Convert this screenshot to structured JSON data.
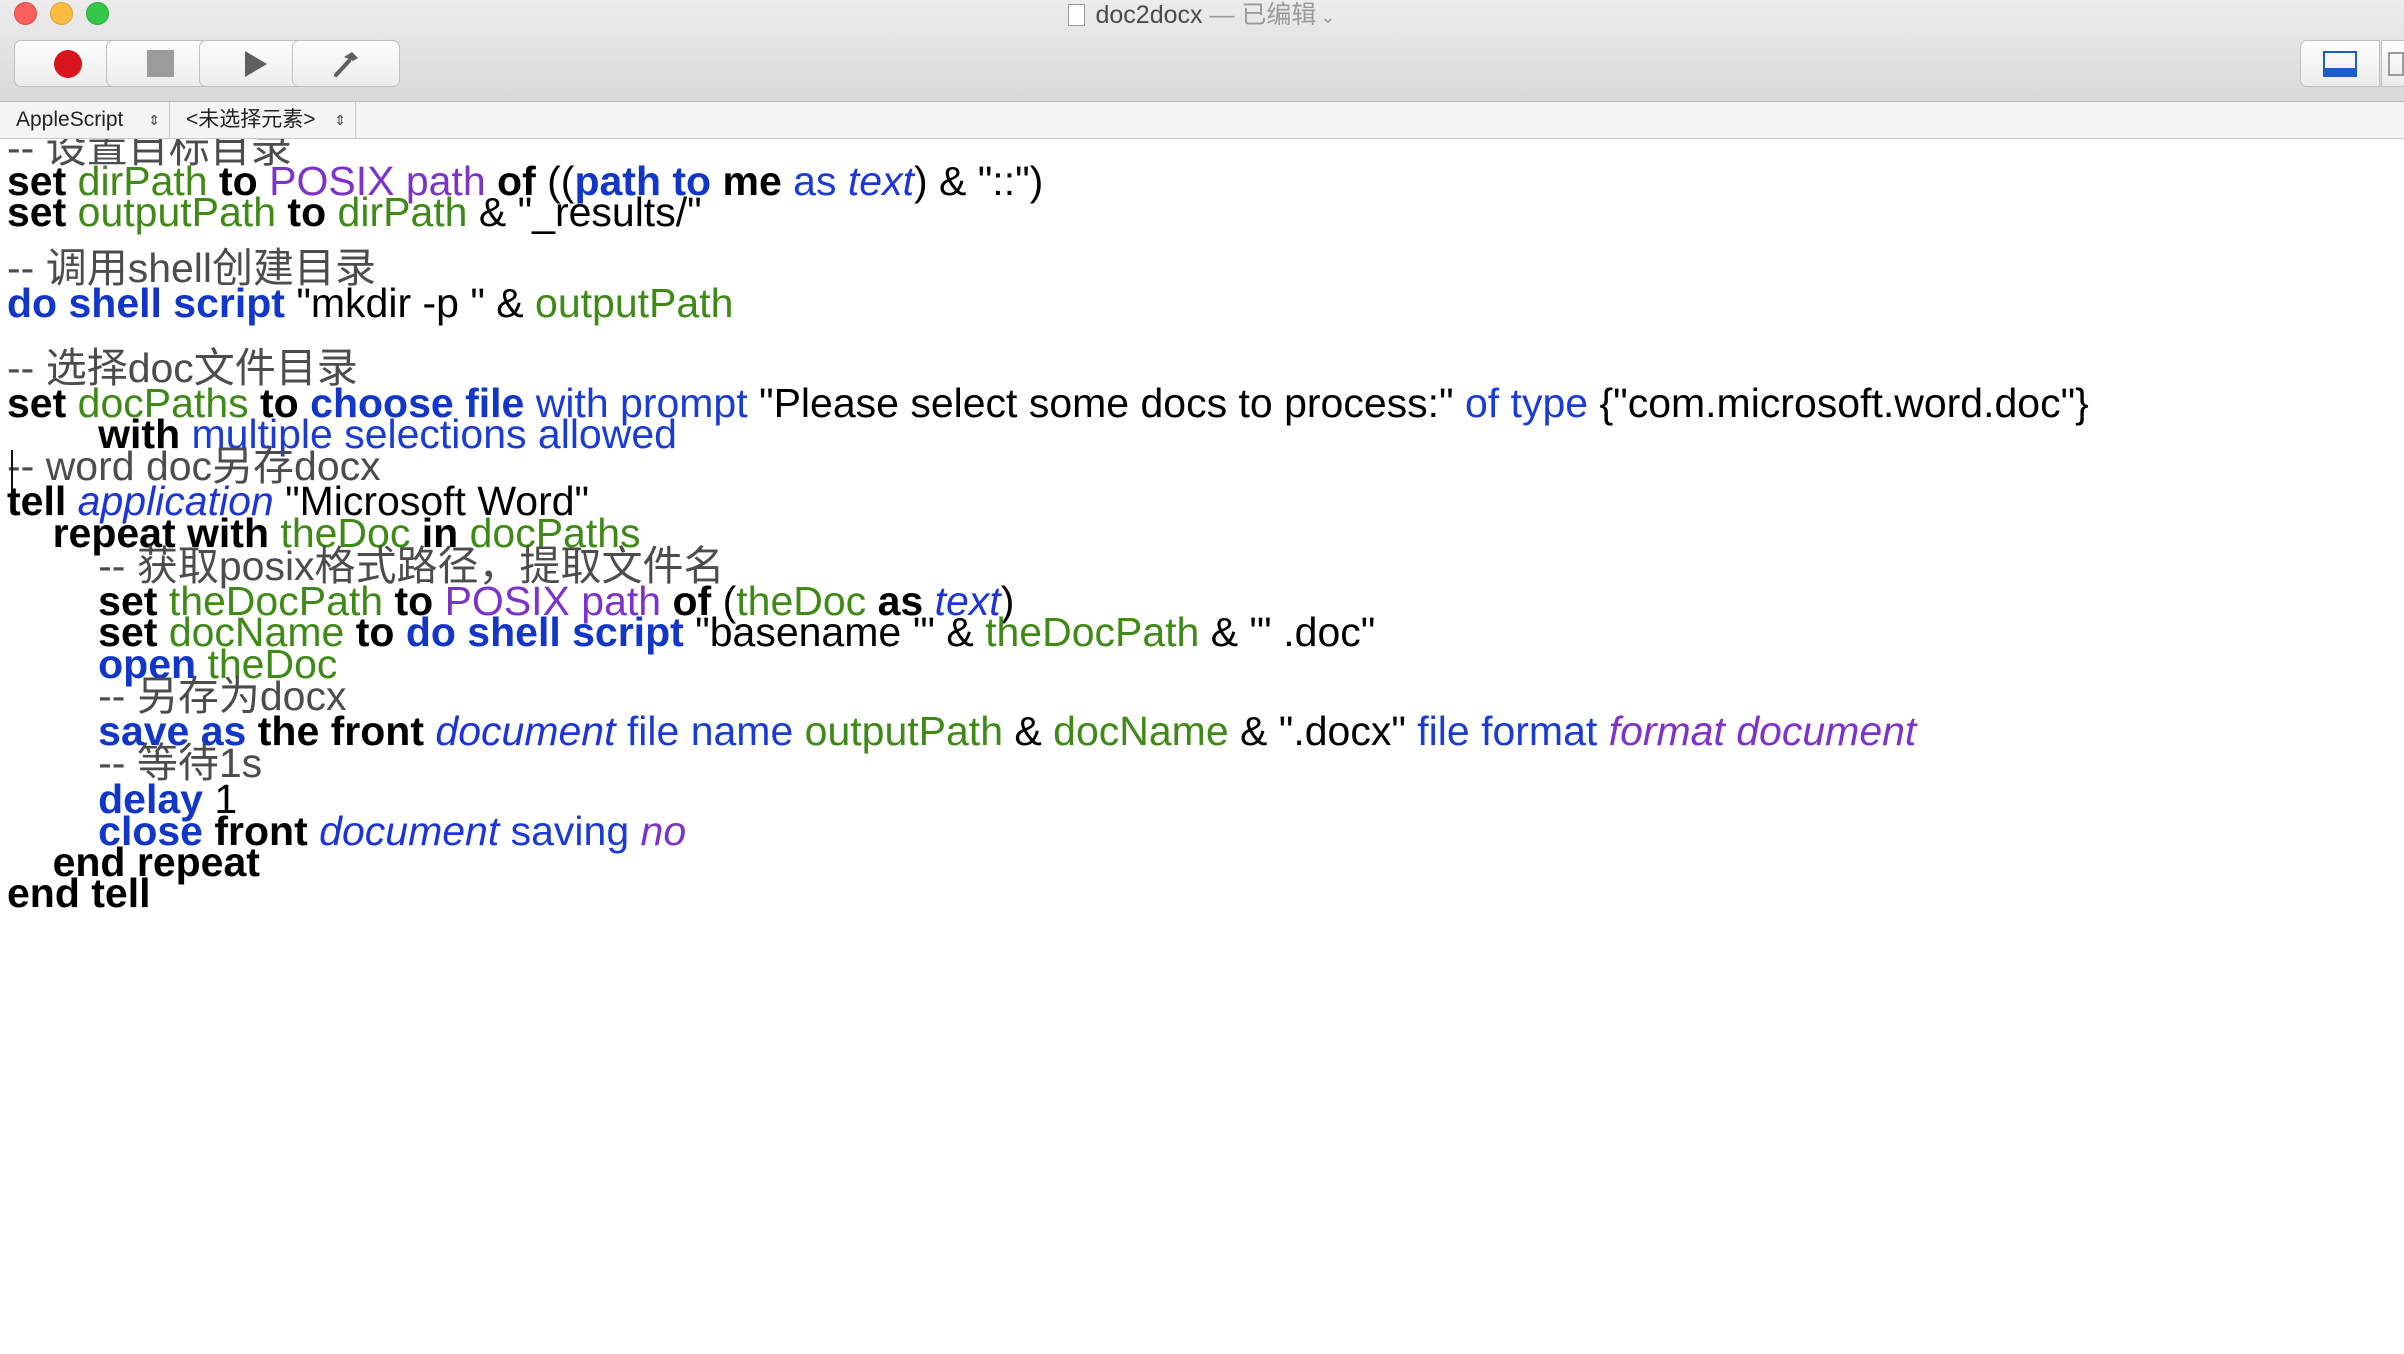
{
  "window": {
    "title": "doc2docx",
    "status": " — 已编辑",
    "chevron": "⌄",
    "traffic_lights": [
      "close",
      "minimize",
      "zoom"
    ]
  },
  "toolbar": {
    "buttons": [
      {
        "name": "record",
        "icon": "record-icon"
      },
      {
        "name": "stop",
        "icon": "stop-icon"
      },
      {
        "name": "run",
        "icon": "play-icon"
      },
      {
        "name": "compile",
        "icon": "hammer-icon"
      }
    ],
    "right_buttons": [
      {
        "name": "show-log",
        "icon": "bottom-panel-icon"
      },
      {
        "name": "show-inspector",
        "icon": "side-panel-icon"
      }
    ]
  },
  "navbar": {
    "language": "AppleScript",
    "element": "<未选择元素>",
    "arrow": "⇕"
  },
  "code": [
    [
      [
        "comment",
        "-- 设置目标目录"
      ]
    ],
    [
      [
        "kw",
        "set"
      ],
      [
        "txt",
        " "
      ],
      [
        "var",
        "dirPath"
      ],
      [
        "txt",
        " "
      ],
      [
        "kw",
        "to"
      ],
      [
        "txt",
        " "
      ],
      [
        "prop",
        "POSIX path"
      ],
      [
        "txt",
        " "
      ],
      [
        "kw",
        "of"
      ],
      [
        "txt",
        " (("
      ],
      [
        "cmd",
        "path to"
      ],
      [
        "txt",
        " "
      ],
      [
        "kw",
        "me"
      ],
      [
        "txt",
        " "
      ],
      [
        "prm",
        "as"
      ],
      [
        "txt",
        " "
      ],
      [
        "cls",
        "text"
      ],
      [
        "txt",
        ") & \"::\")"
      ]
    ],
    [
      [
        "kw",
        "set"
      ],
      [
        "txt",
        " "
      ],
      [
        "var",
        "outputPath"
      ],
      [
        "txt",
        " "
      ],
      [
        "kw",
        "to"
      ],
      [
        "txt",
        " "
      ],
      [
        "var",
        "dirPath"
      ],
      [
        "txt",
        " & \"_results/\""
      ]
    ],
    [],
    [
      [
        "comment",
        "-- 调用shell创建目录"
      ]
    ],
    [
      [
        "cmd",
        "do shell script"
      ],
      [
        "str",
        " \"mkdir -p \" & "
      ],
      [
        "var",
        "outputPath"
      ]
    ],
    [],
    [
      [
        "comment",
        "-- 选择doc文件目录"
      ]
    ],
    [
      [
        "kw",
        "set"
      ],
      [
        "txt",
        " "
      ],
      [
        "var",
        "docPaths"
      ],
      [
        "txt",
        " "
      ],
      [
        "kw",
        "to"
      ],
      [
        "txt",
        " "
      ],
      [
        "cmd",
        "choose file"
      ],
      [
        "txt",
        " "
      ],
      [
        "prm",
        "with prompt"
      ],
      [
        "str",
        " \"Please select some docs to process:\" "
      ],
      [
        "prm",
        "of type"
      ],
      [
        "str",
        " {\"com.microsoft.word.doc\"}"
      ]
    ],
    [
      [
        "txt",
        "        "
      ],
      [
        "kw",
        "with"
      ],
      [
        "txt",
        " "
      ],
      [
        "prm",
        "multiple selections allowed"
      ]
    ],
    [
      [
        "comment",
        "-- word doc另存docx"
      ]
    ],
    [
      [
        "kw",
        "tell"
      ],
      [
        "txt",
        " "
      ],
      [
        "cls",
        "application"
      ],
      [
        "str",
        " \"Microsoft Word\""
      ]
    ],
    [
      [
        "txt",
        "    "
      ],
      [
        "kw",
        "repeat with"
      ],
      [
        "txt",
        " "
      ],
      [
        "var",
        "theDoc"
      ],
      [
        "txt",
        " "
      ],
      [
        "kw",
        "in"
      ],
      [
        "txt",
        " "
      ],
      [
        "var",
        "docPaths"
      ]
    ],
    [
      [
        "txt",
        "        "
      ],
      [
        "comment",
        "-- 获取posix格式路径，提取文件名"
      ]
    ],
    [
      [
        "txt",
        "        "
      ],
      [
        "kw",
        "set"
      ],
      [
        "txt",
        " "
      ],
      [
        "var",
        "theDocPath"
      ],
      [
        "txt",
        " "
      ],
      [
        "kw",
        "to"
      ],
      [
        "txt",
        " "
      ],
      [
        "prop",
        "POSIX path"
      ],
      [
        "txt",
        " "
      ],
      [
        "kw",
        "of"
      ],
      [
        "txt",
        " ("
      ],
      [
        "var",
        "theDoc"
      ],
      [
        "txt",
        " "
      ],
      [
        "kw",
        "as"
      ],
      [
        "txt",
        " "
      ],
      [
        "cls",
        "text"
      ],
      [
        "txt",
        ")"
      ]
    ],
    [
      [
        "txt",
        "        "
      ],
      [
        "kw",
        "set"
      ],
      [
        "txt",
        " "
      ],
      [
        "var",
        "docName"
      ],
      [
        "txt",
        " "
      ],
      [
        "kw",
        "to"
      ],
      [
        "txt",
        " "
      ],
      [
        "cmd",
        "do shell script"
      ],
      [
        "str",
        " \"basename '\" & "
      ],
      [
        "var",
        "theDocPath"
      ],
      [
        "str",
        " & \"' .doc\""
      ]
    ],
    [
      [
        "txt",
        "        "
      ],
      [
        "cmd",
        "open"
      ],
      [
        "txt",
        " "
      ],
      [
        "var",
        "theDoc"
      ]
    ],
    [
      [
        "txt",
        "        "
      ],
      [
        "comment",
        "-- 另存为docx"
      ]
    ],
    [
      [
        "txt",
        "        "
      ],
      [
        "cmd",
        "save as"
      ],
      [
        "txt",
        " "
      ],
      [
        "kw",
        "the front"
      ],
      [
        "txt",
        " "
      ],
      [
        "cls",
        "document"
      ],
      [
        "txt",
        " "
      ],
      [
        "prm",
        "file name"
      ],
      [
        "txt",
        " "
      ],
      [
        "var",
        "outputPath"
      ],
      [
        "txt",
        " & "
      ],
      [
        "var",
        "docName"
      ],
      [
        "str",
        " & \".docx\" "
      ],
      [
        "prm",
        "file format"
      ],
      [
        "txt",
        " "
      ],
      [
        "enm",
        "format document"
      ]
    ],
    [
      [
        "txt",
        "        "
      ],
      [
        "comment",
        "-- 等待1s"
      ]
    ],
    [
      [
        "txt",
        "        "
      ],
      [
        "cmd",
        "delay"
      ],
      [
        "txt",
        " 1"
      ]
    ],
    [
      [
        "txt",
        "        "
      ],
      [
        "cmd",
        "close"
      ],
      [
        "txt",
        " "
      ],
      [
        "kw",
        "front"
      ],
      [
        "txt",
        " "
      ],
      [
        "cls",
        "document"
      ],
      [
        "txt",
        " "
      ],
      [
        "prm",
        "saving"
      ],
      [
        "txt",
        " "
      ],
      [
        "enm",
        "no"
      ]
    ],
    [
      [
        "txt",
        "    "
      ],
      [
        "kw",
        "end repeat"
      ]
    ],
    [
      [
        "kw",
        "end tell"
      ]
    ]
  ],
  "colors": {
    "keyword": "#000000",
    "command": "#1236c8",
    "variable": "#3f8a17",
    "property": "#7d33c9",
    "class": "#1c34d8",
    "comment": "#4c4c4c"
  }
}
